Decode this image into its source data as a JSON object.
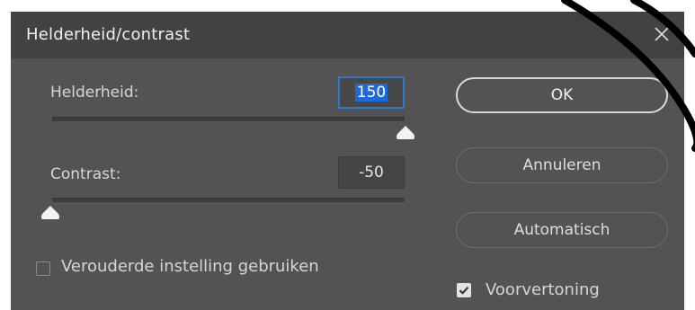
{
  "dialog": {
    "title": "Helderheid/contrast",
    "close_icon": "close-icon"
  },
  "brightness": {
    "label": "Helderheid:",
    "value": "150",
    "slider_fraction": 1.0
  },
  "contrast": {
    "label": "Contrast:",
    "value": "-50",
    "slider_fraction": 0.0
  },
  "legacy": {
    "label": "Verouderde instelling gebruiken",
    "checked": false
  },
  "buttons": {
    "ok": "OK",
    "cancel": "Annuleren",
    "auto": "Automatisch"
  },
  "preview": {
    "label": "Voorvertoning",
    "checked": true
  },
  "colors": {
    "dialog_bg": "#535353",
    "titlebar_bg": "#424242",
    "focus_blue": "#2f77c9"
  }
}
